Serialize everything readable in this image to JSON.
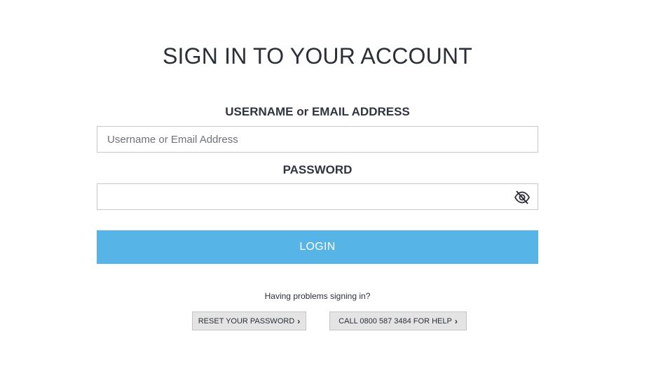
{
  "page": {
    "title": "SIGN IN TO YOUR ACCOUNT"
  },
  "form": {
    "username_label": "USERNAME or EMAIL ADDRESS",
    "username_placeholder": "Username or Email Address",
    "username_value": "",
    "password_label": "PASSWORD",
    "password_value": "",
    "password_toggle_icon": "eye-slash-icon",
    "login_label": "LOGIN",
    "login_color": "#57b4e6"
  },
  "help": {
    "prompt": "Having problems signing in?",
    "reset_label": "RESET YOUR PASSWORD",
    "call_label": "CALL 0800 587 3484 FOR HELP",
    "chevron": "›"
  }
}
